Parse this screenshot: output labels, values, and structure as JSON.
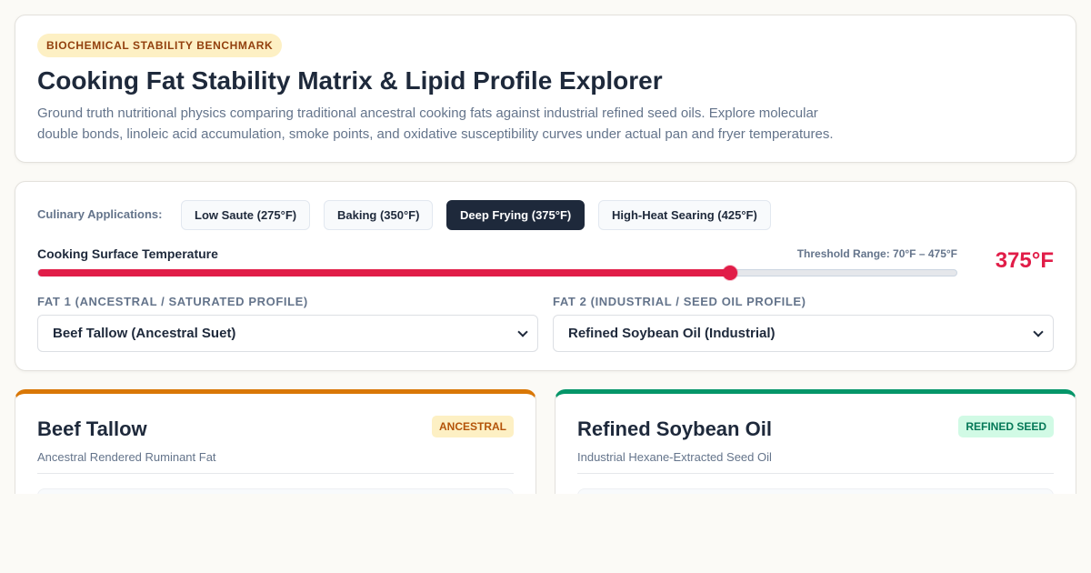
{
  "header": {
    "badge": "BIOCHEMICAL STABILITY BENCHMARK",
    "title": "Cooking Fat Stability Matrix & Lipid Profile Explorer",
    "description": "Ground truth nutritional physics comparing traditional ancestral cooking fats against industrial refined seed oils. Explore molecular double bonds, linoleic acid accumulation, smoke points, and oxidative susceptibility curves under actual pan and fryer temperatures."
  },
  "controls": {
    "applications_label": "Culinary Applications:",
    "applications": [
      {
        "label": "Low Saute (275°F)",
        "active": false
      },
      {
        "label": "Baking (350°F)",
        "active": false
      },
      {
        "label": "Deep Frying (375°F)",
        "active": true
      },
      {
        "label": "High-Heat Searing (425°F)",
        "active": false
      }
    ],
    "temperature": {
      "label": "Cooking Surface Temperature",
      "threshold_label": "Threshold Range: 70°F – 475°F",
      "min": 70,
      "max": 475,
      "value": 375,
      "value_display": "375°F"
    },
    "fat1": {
      "label": "FAT 1 (ANCESTRAL / SATURATED PROFILE)",
      "selected": "Beef Tallow (Ancestral Suet)"
    },
    "fat2": {
      "label": "FAT 2 (INDUSTRIAL / SEED OIL PROFILE)",
      "selected": "Refined Soybean Oil (Industrial)"
    }
  },
  "cards": [
    {
      "name": "Beef Tallow",
      "subtitle": "Ancestral Rendered Ruminant Fat",
      "badge": "ANCESTRAL",
      "accent": "#d97706"
    },
    {
      "name": "Refined Soybean Oil",
      "subtitle": "Industrial Hexane-Extracted Seed Oil",
      "badge": "REFINED SEED",
      "accent": "#059669"
    }
  ],
  "colors": {
    "accent_temperature": "#e11d48",
    "active_button": "#1e293b",
    "ancestral": "#d97706",
    "seed_oil": "#059669"
  }
}
